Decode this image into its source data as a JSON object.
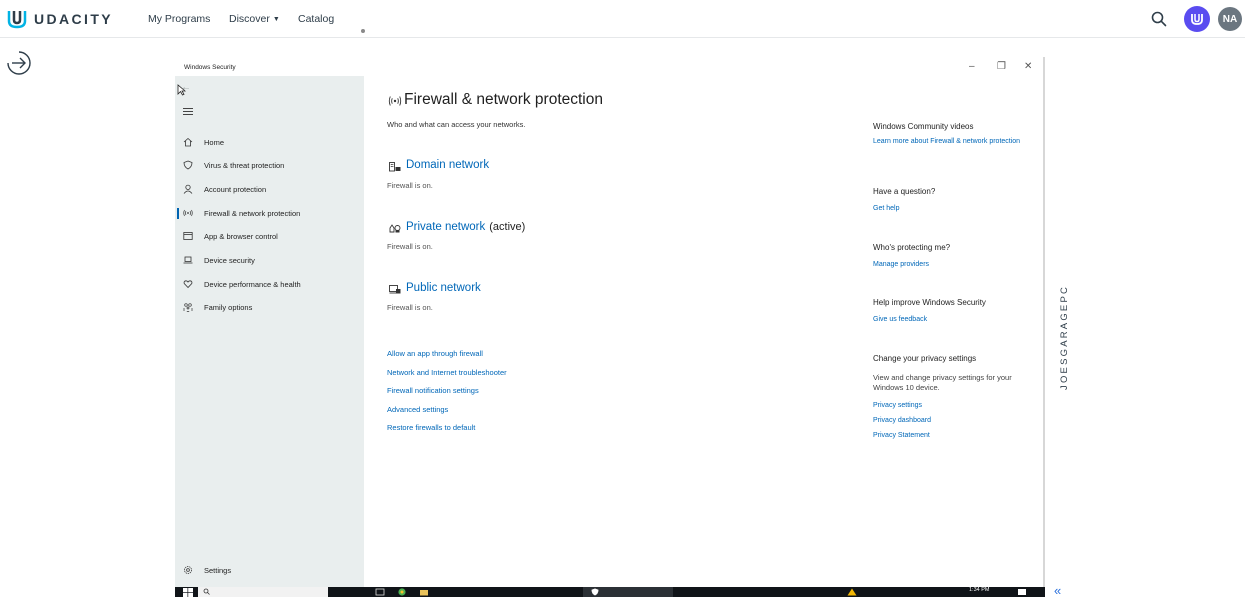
{
  "colors": {
    "brand": "#02b3e4",
    "udacity_purple": "#5a4cf0",
    "link_blue": "#0067b8",
    "sidebar_bg": "#e9eeee"
  },
  "header": {
    "logo_text": "UDACITY",
    "nav": {
      "my_programs": "My Programs",
      "discover": "Discover",
      "catalog": "Catalog"
    },
    "user_initials": "NA",
    "icons": [
      "udacity-logo-icon",
      "search-icon",
      "udacity-u-icon",
      "chevron-down-icon"
    ]
  },
  "window": {
    "title": "Windows Security",
    "controls": {
      "minimize": "–",
      "restore": "❐",
      "close": "✕"
    }
  },
  "sidebar": {
    "items": [
      {
        "label": "Home",
        "icon": "home-icon"
      },
      {
        "label": "Virus & threat protection",
        "icon": "shield-icon"
      },
      {
        "label": "Account protection",
        "icon": "person-icon"
      },
      {
        "label": "Firewall & network protection",
        "icon": "antenna-icon",
        "active": true
      },
      {
        "label": "App & browser control",
        "icon": "browser-window-icon"
      },
      {
        "label": "Device security",
        "icon": "laptop-icon"
      },
      {
        "label": "Device performance & health",
        "icon": "heart-icon"
      },
      {
        "label": "Family options",
        "icon": "family-icon"
      }
    ],
    "settings_label": "Settings"
  },
  "main": {
    "title": "Firewall & network protection",
    "subtitle": "Who and what can access your networks.",
    "networks": [
      {
        "name": "Domain network",
        "status": "Firewall is on.",
        "active_label": "",
        "icon": "domain-network-icon"
      },
      {
        "name": "Private network",
        "status": "Firewall is on.",
        "active_label": "(active)",
        "icon": "private-network-icon"
      },
      {
        "name": "Public network",
        "status": "Firewall is on.",
        "active_label": "",
        "icon": "public-network-icon"
      }
    ],
    "links": [
      "Allow an app through firewall",
      "Network and Internet troubleshooter",
      "Firewall notification settings",
      "Advanced settings",
      "Restore firewalls to default"
    ]
  },
  "right_panel": {
    "community": {
      "heading": "Windows Community videos",
      "link": "Learn more about Firewall & network protection"
    },
    "question": {
      "heading": "Have a question?",
      "link": "Get help"
    },
    "protecting": {
      "heading": "Who's protecting me?",
      "link": "Manage providers"
    },
    "improve": {
      "heading": "Help improve Windows Security",
      "link": "Give us feedback"
    },
    "privacy": {
      "heading": "Change your privacy settings",
      "text": "View and change privacy settings for your Windows 10 device.",
      "links": [
        "Privacy settings",
        "Privacy dashboard",
        "Privacy Statement"
      ]
    }
  },
  "vertical_label": "JOESGARAGEPC",
  "taskbar": {
    "time": "1:34 PM"
  }
}
